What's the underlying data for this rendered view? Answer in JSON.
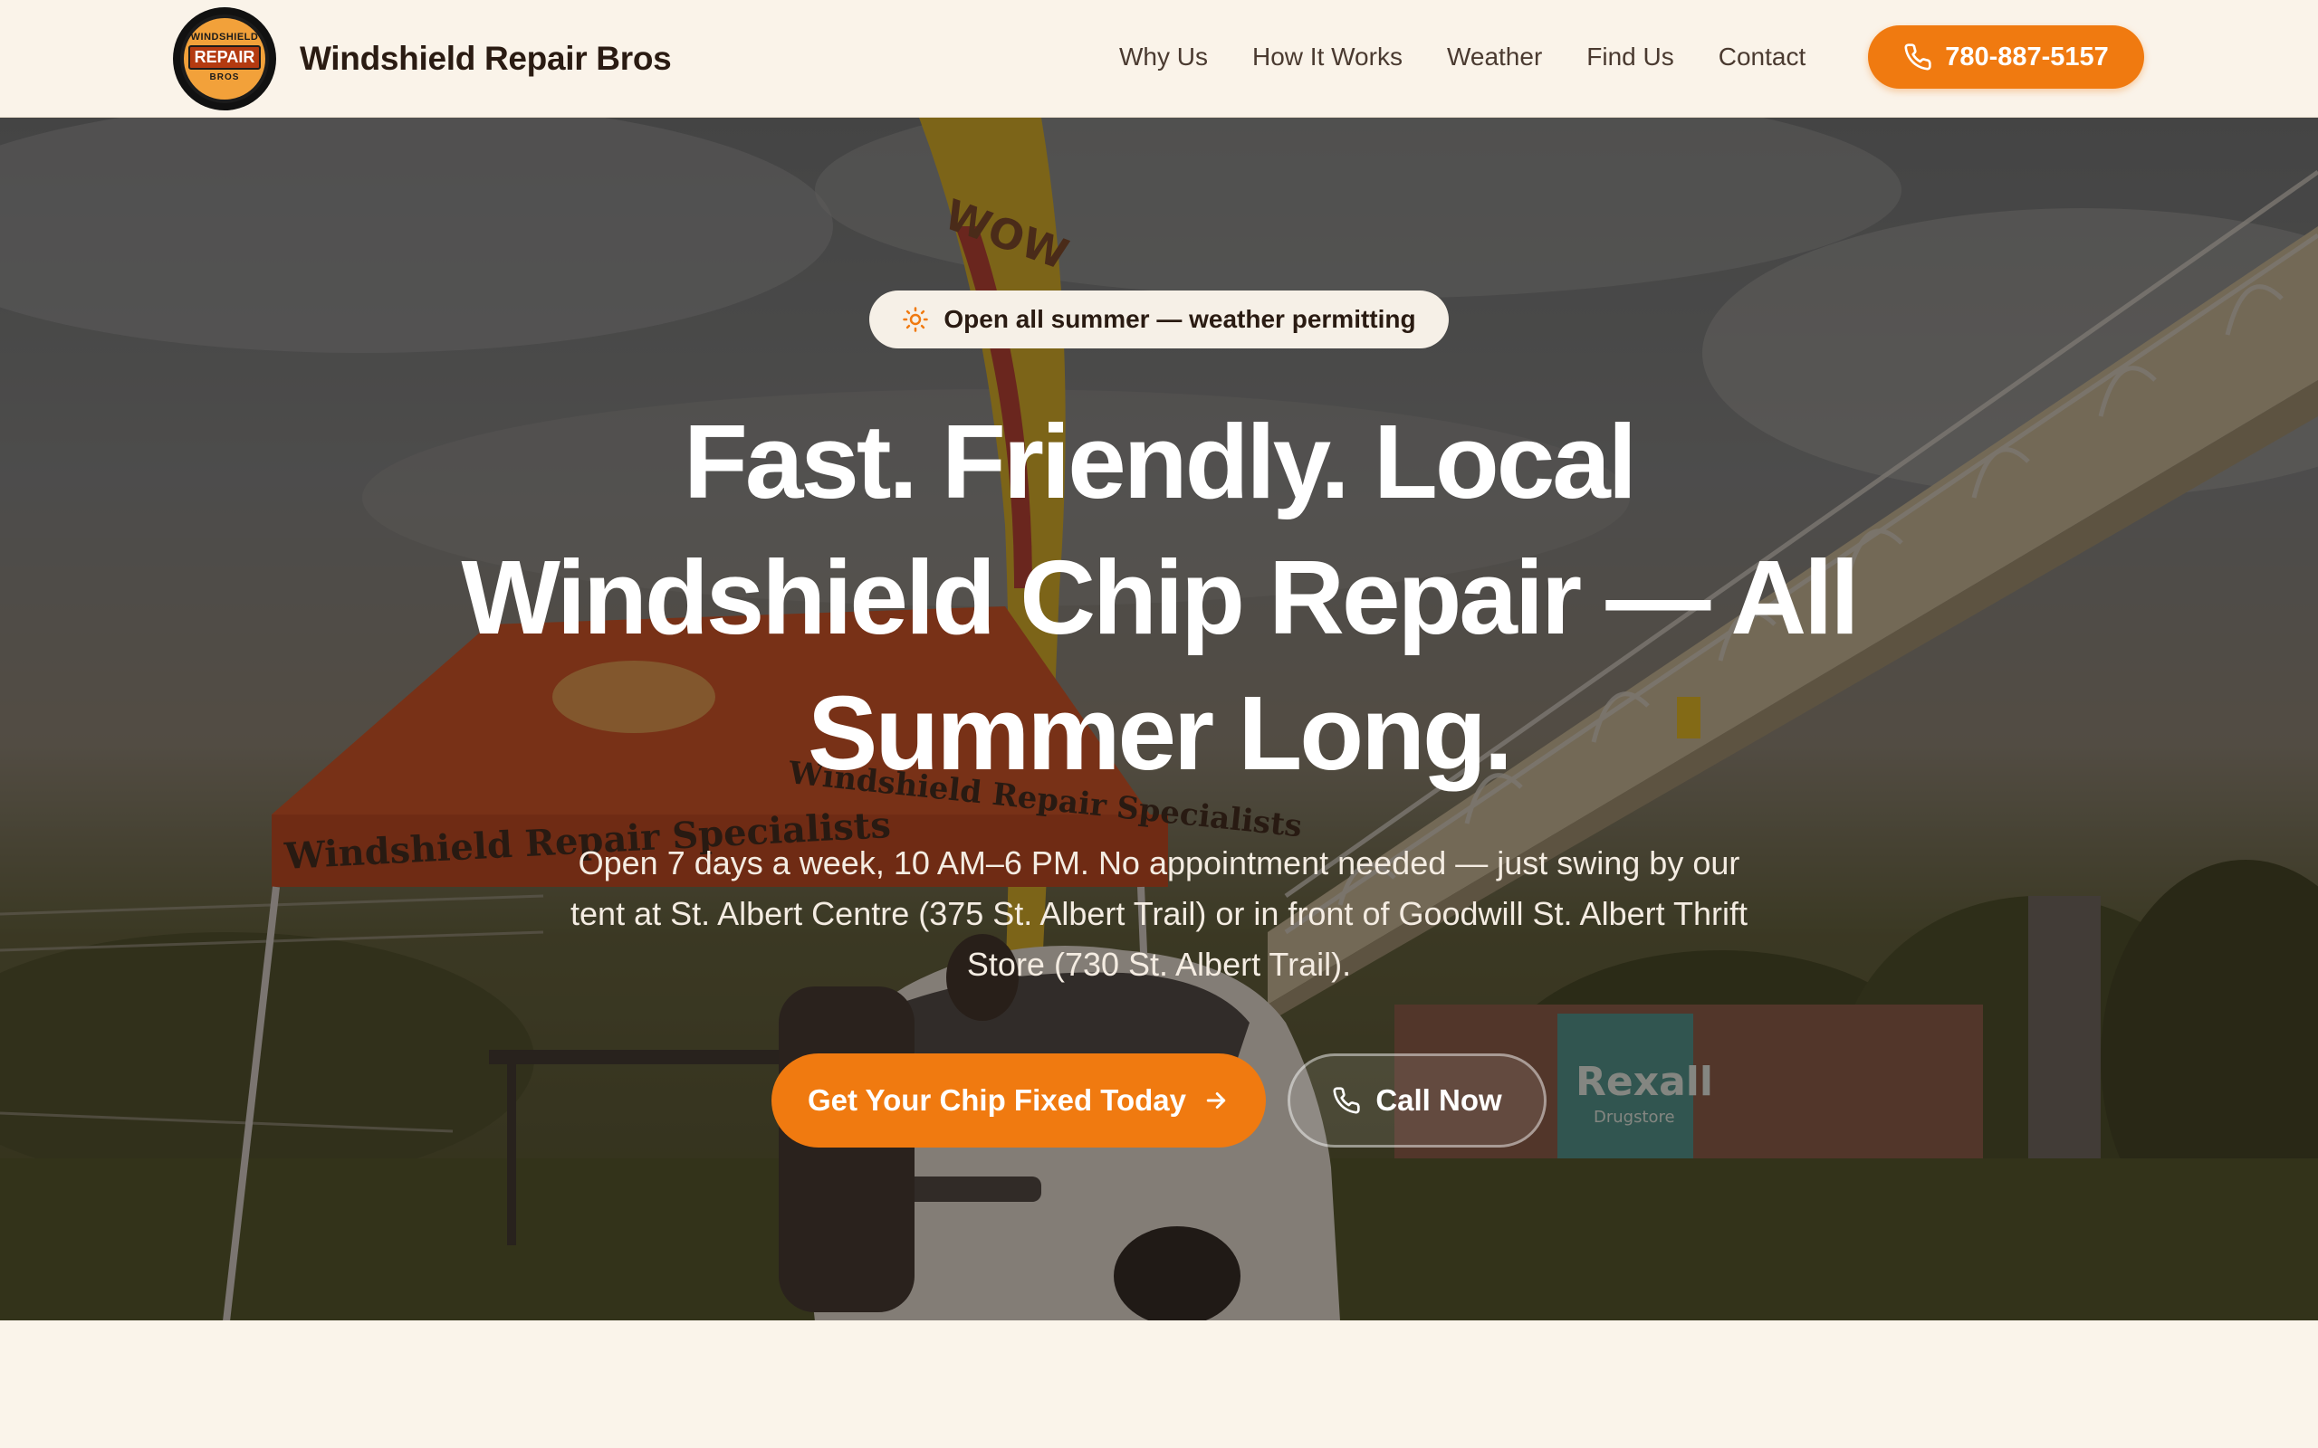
{
  "header": {
    "logo": {
      "top_text": "WINDSHIELD",
      "mid_text": "REPAIR",
      "bottom_text": "BROS"
    },
    "brand_name": "Windshield Repair Bros",
    "nav": [
      "Why Us",
      "How It Works",
      "Weather",
      "Find Us",
      "Contact"
    ],
    "phone": "780-887-5157",
    "phone_icon": "phone-icon"
  },
  "hero": {
    "badge": "Open all summer — weather permitting",
    "badge_icon": "sun-icon",
    "headline_lines": [
      "Fast. Friendly. Local",
      "Windshield Chip Repair — All",
      "Summer Long."
    ],
    "subtext": "Open 7 days a week, 10 AM–6 PM. No appointment needed — just swing by our tent at St. Albert Centre (375 St. Albert Trail) or in front of Goodwill St. Albert Thrift Store (730 St. Albert Trail).",
    "primary_cta": "Get Your Chip Fixed Today",
    "primary_cta_icon": "arrow-right-icon",
    "secondary_cta": "Call Now",
    "secondary_cta_icon": "phone-icon",
    "background_photo_texts": {
      "flag": "WOW",
      "tent_front": "Windshield Repair Specialists",
      "tent_side": "Windshield Repair Specialists",
      "store_sign": "Rexall",
      "store_sub": "Drugstore"
    }
  },
  "colors": {
    "accent": "#f07a10",
    "header_bg": "#faf3e9",
    "text_dark": "#2a1b12"
  }
}
